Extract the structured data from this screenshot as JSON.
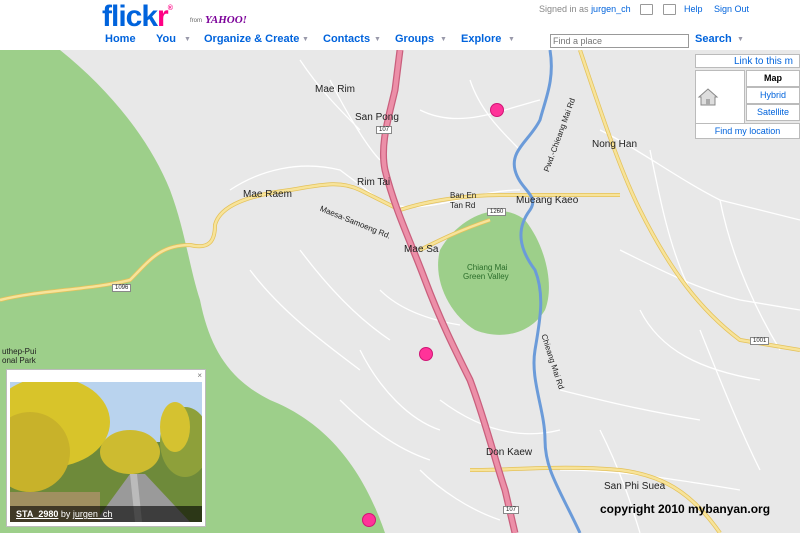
{
  "header": {
    "logo_blue": "flick",
    "logo_pink": "r",
    "logo_reg": "®",
    "from": "from",
    "yahoo": "YAHOO!",
    "signed_in_as": "Signed in as",
    "username": "jurgen_ch",
    "help": "Help",
    "sign_out": "Sign Out",
    "nav": [
      "Home",
      "You",
      "Organize & Create",
      "Contacts",
      "Groups",
      "Explore"
    ],
    "search_placeholder": "Find a place",
    "search_label": "Search"
  },
  "map_controls": {
    "link_to_map": "Link to this m",
    "map": "Map",
    "hybrid": "Hybrid",
    "satellite": "Satellite",
    "find_location": "Find my location"
  },
  "places": {
    "mae_rim": "Mae Rim",
    "san_pong": "San Pong",
    "rim_tai": "Rim Tai",
    "mae_raem": "Mae Raem",
    "mae_sa": "Mae Sa",
    "ban_en_1": "Ban En",
    "ban_en_2": "Tan Rd",
    "mueang_kaeo": "Mueang Kaeo",
    "nong_han": "Nong Han",
    "chiang_mai_green_1": "Chiang Mai",
    "chiang_mai_green_2": "Green Valley",
    "don_kaew": "Don Kaew",
    "san_phi_suea": "San Phi Suea",
    "suthep_1": "uthep-Pui",
    "suthep_2": "onal Park",
    "maesa_samoeng": "Maesa-Samoeng Rd.",
    "pwd_chieang": "Pwd.-Chieang Mai Rd",
    "chieang_mai_rd": "Chieang Mai Rd"
  },
  "road_shields": {
    "r107a": "107",
    "r107b": "107",
    "r1260": "1260",
    "r1096": "1096",
    "r1001": "1001"
  },
  "photo": {
    "title": "STA_2980",
    "by": "by",
    "owner": "jurgen_ch",
    "close": "×"
  },
  "copyright": "copyright 2010 mybanyan.org",
  "colors": {
    "flickr_blue": "#0063dc",
    "flickr_pink": "#ff0084",
    "park_green": "#9dcf8a",
    "highway_red": "#e07a94",
    "river_blue": "#6b9bd9",
    "road_yellow": "#f3d46b"
  }
}
